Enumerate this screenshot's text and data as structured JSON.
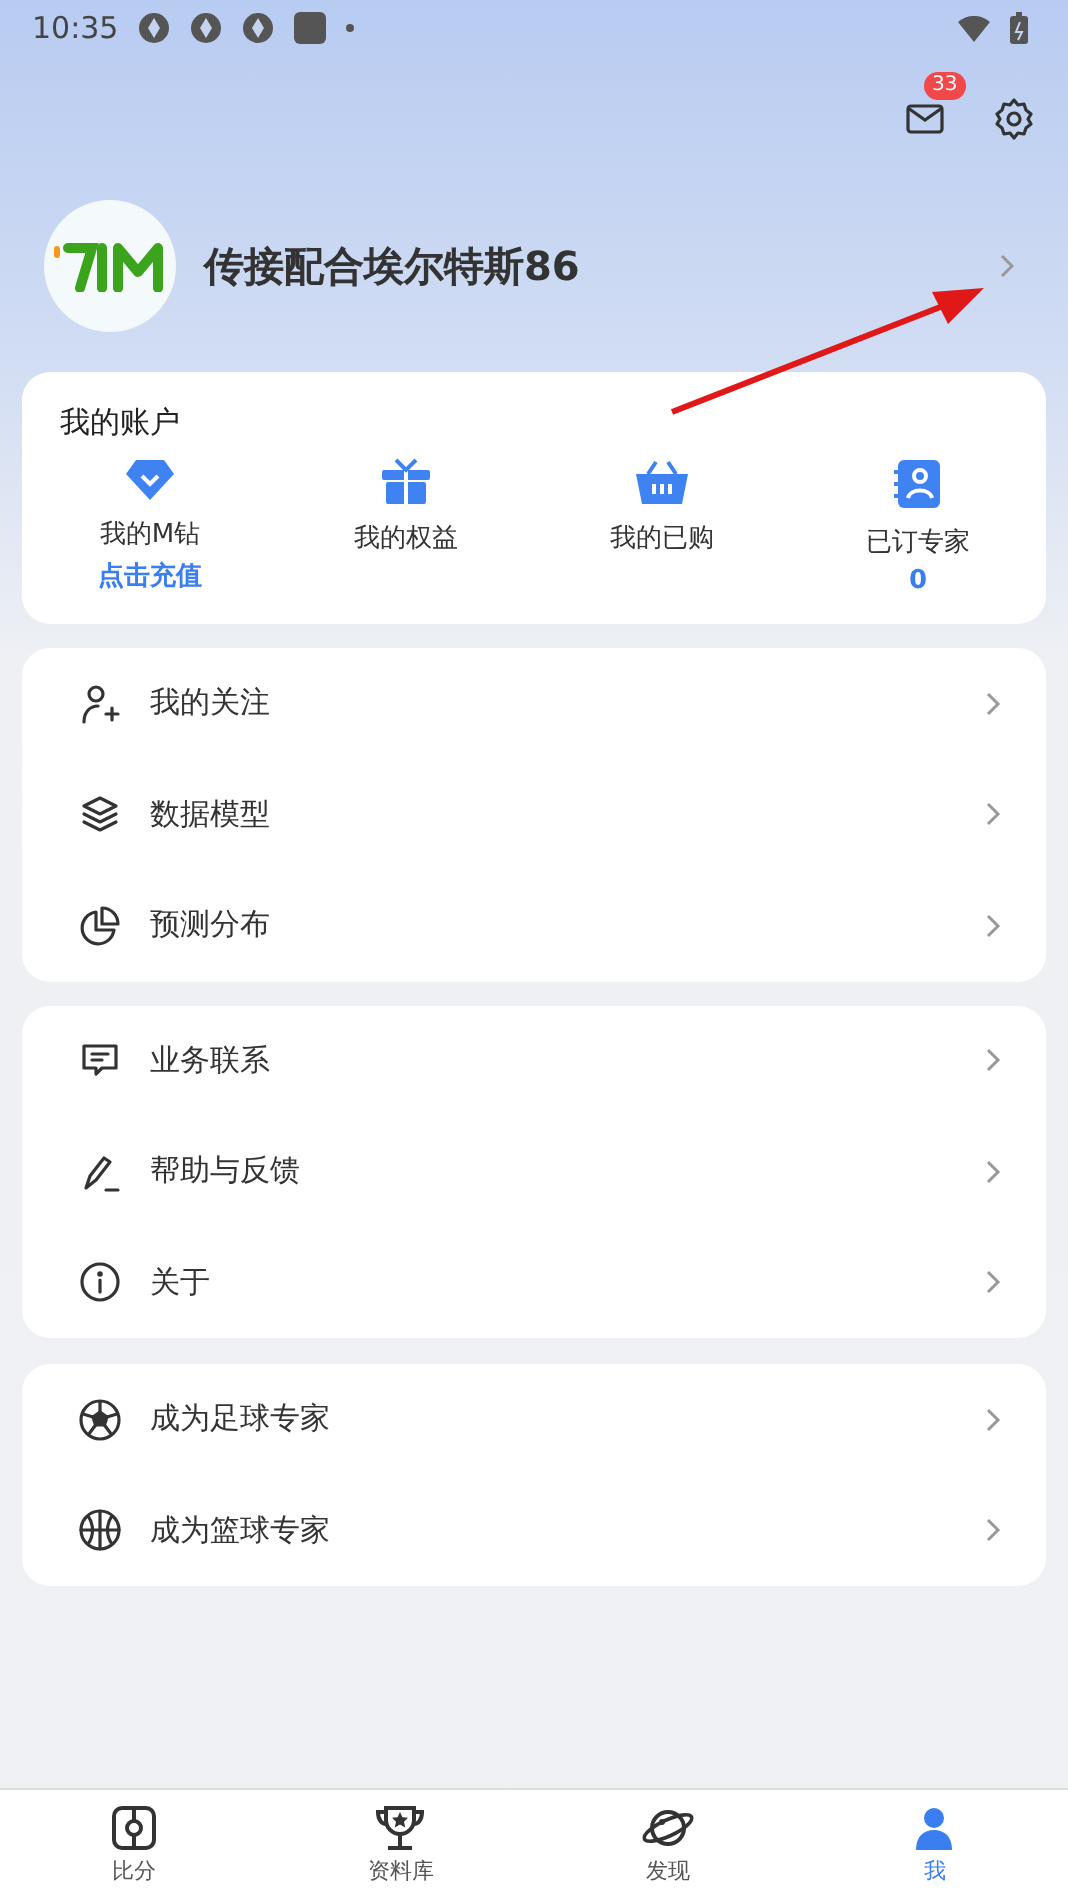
{
  "status_bar": {
    "time": "10:35"
  },
  "header": {
    "mail_badge": "33"
  },
  "profile": {
    "name": "传接配合埃尔特斯86"
  },
  "account": {
    "title": "我的账户",
    "items": [
      {
        "label": "我的M钻",
        "sub": "点击充值"
      },
      {
        "label": "我的权益"
      },
      {
        "label": "我的已购"
      },
      {
        "label": "已订专家",
        "sub": "0"
      }
    ]
  },
  "menu_groups": [
    [
      {
        "label": "我的关注"
      },
      {
        "label": "数据模型"
      },
      {
        "label": "预测分布"
      }
    ],
    [
      {
        "label": "业务联系"
      },
      {
        "label": "帮助与反馈"
      },
      {
        "label": "关于"
      }
    ],
    [
      {
        "label": "成为足球专家"
      },
      {
        "label": "成为篮球专家"
      }
    ]
  ],
  "tab_bar": [
    {
      "label": "比分",
      "selected": false
    },
    {
      "label": "资料库",
      "selected": false
    },
    {
      "label": "发现",
      "selected": false
    },
    {
      "label": "我",
      "selected": true
    }
  ]
}
